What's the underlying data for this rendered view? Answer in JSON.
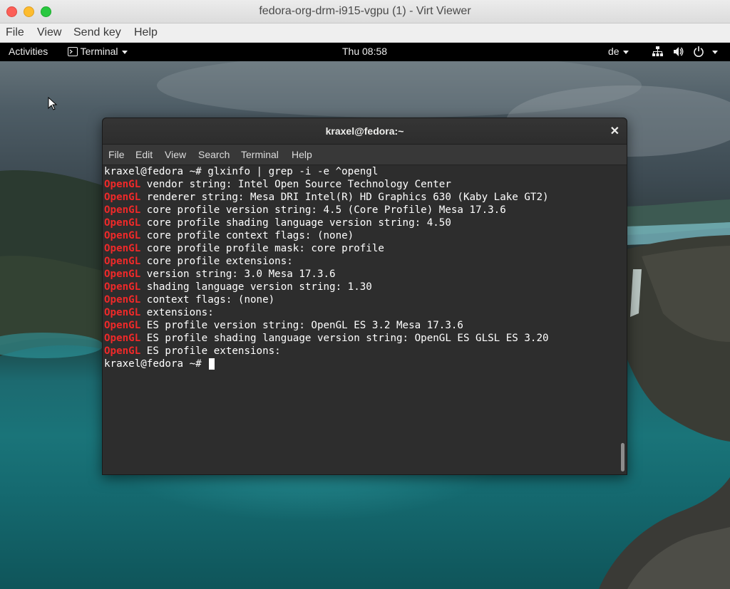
{
  "host_window": {
    "title": "fedora-org-drm-i915-vgpu (1) - Virt Viewer",
    "menu": [
      "File",
      "View",
      "Send key",
      "Help"
    ]
  },
  "gnome": {
    "activities": "Activities",
    "app_menu": "Terminal",
    "clock": "Thu 08:58",
    "keyboard_layout": "de",
    "tray_icons": [
      "network-icon",
      "volume-icon",
      "power-icon"
    ]
  },
  "terminal": {
    "title": "kraxel@fedora:~",
    "menu": [
      "File",
      "Edit",
      "View",
      "Search",
      "Terminal",
      "Help"
    ],
    "prompt": "kraxel@fedora ~# ",
    "command": "glxinfo | grep -i -e ^opengl",
    "keyword": "OpenGL",
    "output": [
      " vendor string: Intel Open Source Technology Center",
      " renderer string: Mesa DRI Intel(R) HD Graphics 630 (Kaby Lake GT2)",
      " core profile version string: 4.5 (Core Profile) Mesa 17.3.6",
      " core profile shading language version string: 4.50",
      " core profile context flags: (none)",
      " core profile profile mask: core profile",
      " core profile extensions:",
      " version string: 3.0 Mesa 17.3.6",
      " shading language version string: 1.30",
      " context flags: (none)",
      " extensions:",
      " ES profile version string: OpenGL ES 3.2 Mesa 17.3.6",
      " ES profile shading language version string: OpenGL ES GLSL ES 3.20",
      " ES profile extensions:"
    ]
  },
  "colors": {
    "keyword_red": "#ef2929",
    "terminal_bg": "#2d2d2d",
    "gnome_bar": "#000000"
  }
}
